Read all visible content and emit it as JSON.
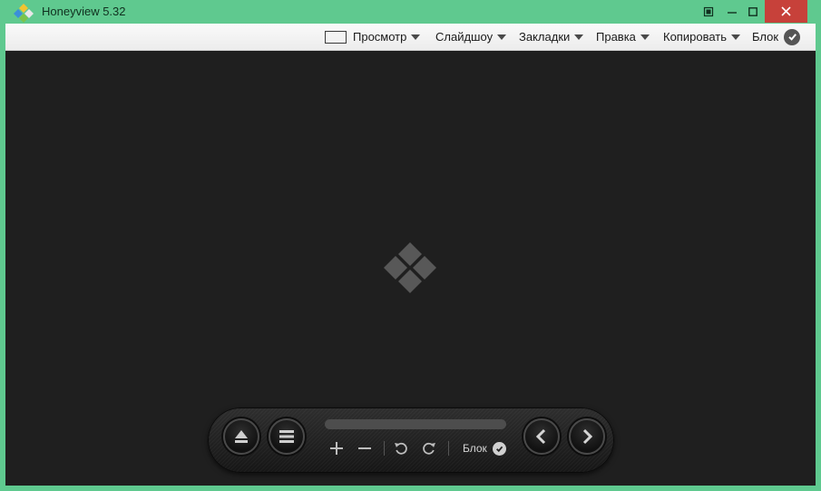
{
  "window": {
    "title": "Honeyview 5.32"
  },
  "menu": {
    "view": "Просмотр",
    "slideshow": "Слайдшоу",
    "bookmarks": "Закладки",
    "edit": "Правка",
    "copy": "Копировать",
    "block": "Блок"
  },
  "panel": {
    "block_label": "Блок"
  },
  "colors": {
    "frame": "#5fc98f",
    "close": "#c7413a",
    "viewer_bg": "#1f1f1f"
  },
  "icons": {
    "app": "honeyview-logo-icon",
    "fullscreen": "fullscreen-icon",
    "check": "check-circle-icon",
    "eject": "eject-icon",
    "menu": "hamburger-icon",
    "zoom_in": "plus-icon",
    "zoom_out": "minus-icon",
    "rotate_left": "rotate-left-icon",
    "rotate_right": "rotate-right-icon",
    "prev": "chevron-left-icon",
    "next": "chevron-right-icon"
  }
}
